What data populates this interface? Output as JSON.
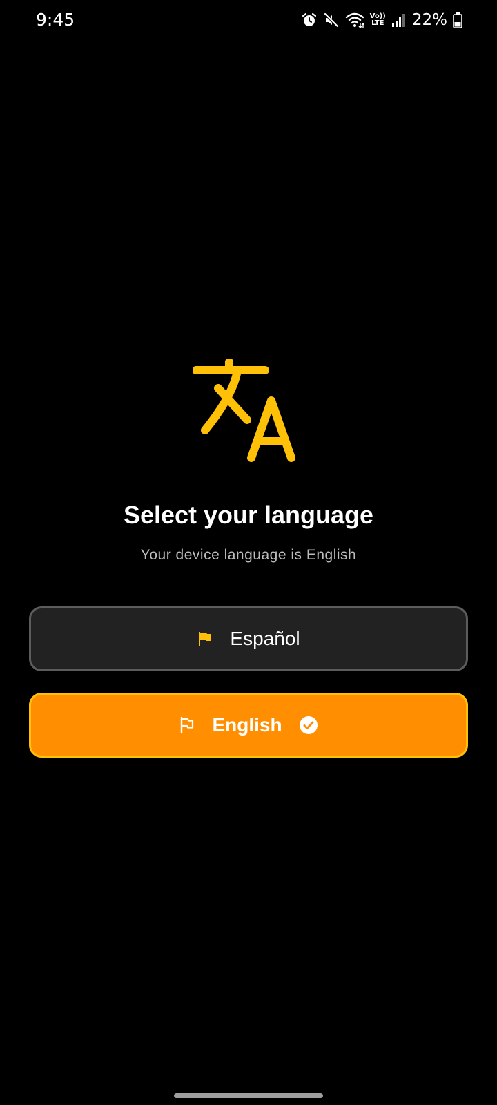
{
  "status_bar": {
    "time": "9:45",
    "battery": "22%",
    "network_badge_top": "Vo))",
    "network_badge_bottom": "LTE",
    "icons": [
      "alarm-icon",
      "mute-icon",
      "wifi-icon",
      "volte-icon",
      "signal-icon",
      "battery-icon"
    ]
  },
  "header": {
    "icon": "translate-icon",
    "title": "Select your language",
    "subtitle": "Your device language is English"
  },
  "languages": [
    {
      "label": "Español",
      "icon": "flag-filled-icon",
      "selected": false
    },
    {
      "label": "English",
      "icon": "flag-outline-icon",
      "selected": true,
      "check_icon": "check-circle-icon"
    }
  ],
  "colors": {
    "background": "#000000",
    "accent": "#ffc107",
    "selected_fill": "#ff8f00",
    "unselected_fill": "#222222",
    "unselected_border": "#5c5c5c",
    "subtitle": "#bdbdbd"
  }
}
